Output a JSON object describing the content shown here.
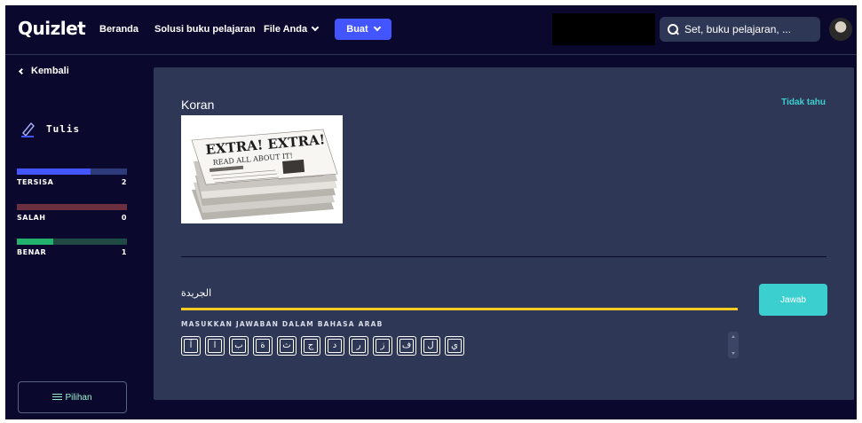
{
  "header": {
    "logo": "Quizlet",
    "nav": {
      "home": "Beranda",
      "solutions": "Solusi buku pelajaran",
      "files": "File Anda"
    },
    "create_label": "Buat",
    "search_placeholder": "Set, buku pelajaran, ..."
  },
  "sidebar": {
    "back_label": "Kembali",
    "mode_label": "Tulis",
    "stats": [
      {
        "label": "TERSISA",
        "value": "2",
        "fraction": 0.67,
        "track_color": "#2e3a7a",
        "fill_color": "#4255ff"
      },
      {
        "label": "SALAH",
        "value": "0",
        "fraction": 0.0,
        "track_color": "#6b3040",
        "fill_color": "#ff725b"
      },
      {
        "label": "BENAR",
        "value": "1",
        "fraction": 0.33,
        "track_color": "#1f4a44",
        "fill_color": "#23b26d"
      }
    ],
    "options_label": "Pilihan"
  },
  "card": {
    "term": "Koran",
    "dont_know": "Tidak tahu",
    "answer_value": "الجريدة",
    "hint": "MASUKKAN JAWABAN DALAM BAHASA ARAB",
    "answer_button": "Jawab",
    "keys": [
      "آ",
      "ا",
      "ب",
      "ة",
      "ث",
      "ج",
      "د",
      "ر",
      "ز",
      "ف",
      "ل",
      "ي"
    ]
  },
  "colors": {
    "background": "#0a092d",
    "card": "#2e3856",
    "accent": "#4255ff",
    "teal": "#3ccfcf",
    "underline": "#ffcd1f"
  }
}
